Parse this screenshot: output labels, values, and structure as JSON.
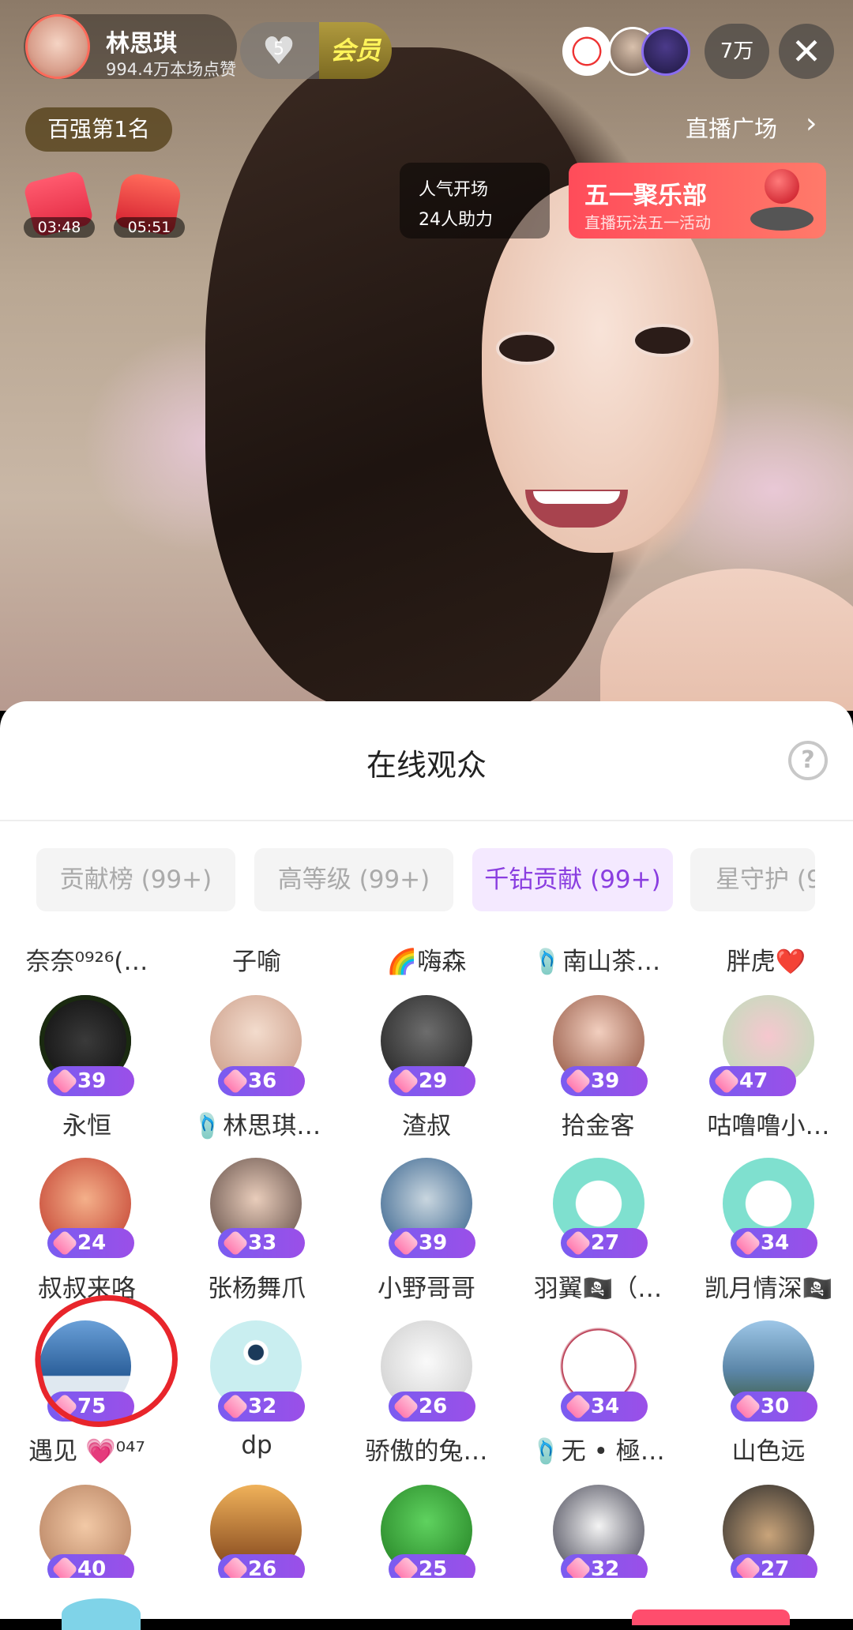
{
  "host": {
    "name": "林思琪",
    "likes": "994.4万本场点赞",
    "rank": "百强第1名"
  },
  "header": {
    "fan_level": "5",
    "vip_label": "会员",
    "audience_count": "7万",
    "close": "✕"
  },
  "nav": {
    "square_label": "直播广场",
    "square_chevron": "›"
  },
  "envelopes": [
    {
      "timer": "03:48"
    },
    {
      "timer": "05:51"
    }
  ],
  "popularity": {
    "line1": "人气开场",
    "line2": "24人助力"
  },
  "event": {
    "title": "五一聚乐部",
    "subtitle": "直播玩法五一活动"
  },
  "sheet": {
    "title": "在线观众",
    "help": "?"
  },
  "tabs": [
    {
      "label": "贡献榜 (99+)"
    },
    {
      "label": "高等级 (99+)"
    },
    {
      "label": "千钻贡献 (99+)"
    },
    {
      "label": "星守护 (9"
    }
  ],
  "top_names": [
    "奈奈⁰⁹²⁶(…",
    "子喻",
    "🌈嗨森",
    "🩴南山茶…",
    "胖虎❤️"
  ],
  "viewers": [
    [
      {
        "level": "39",
        "name": "永恒"
      },
      {
        "level": "36",
        "name": "🩴林思琪…"
      },
      {
        "level": "29",
        "name": "渣叔"
      },
      {
        "level": "39",
        "name": "拾金客"
      },
      {
        "level": "47",
        "name": "咕噜噜小…"
      }
    ],
    [
      {
        "level": "24",
        "name": "叔叔来咯"
      },
      {
        "level": "33",
        "name": "张杨舞爪"
      },
      {
        "level": "39",
        "name": "小野哥哥"
      },
      {
        "level": "27",
        "name": "羽翼🏴‍☠️（…"
      },
      {
        "level": "34",
        "name": "凯月情深🏴‍☠️"
      }
    ],
    [
      {
        "level": "75",
        "name": "遇见 💗⁰⁴⁷"
      },
      {
        "level": "32",
        "name": "dp"
      },
      {
        "level": "26",
        "name": "骄傲的兔…"
      },
      {
        "level": "34",
        "name": "🩴无 • 極…"
      },
      {
        "level": "30",
        "name": "山色远"
      }
    ],
    [
      {
        "level": "40",
        "name": ""
      },
      {
        "level": "26",
        "name": ""
      },
      {
        "level": "25",
        "name": ""
      },
      {
        "level": "32",
        "name": ""
      },
      {
        "level": "27",
        "name": ""
      }
    ]
  ],
  "colors": {
    "accent": "#8a3ee0",
    "level_badge": "#7a5cf0",
    "annotation": "#e8252b"
  }
}
